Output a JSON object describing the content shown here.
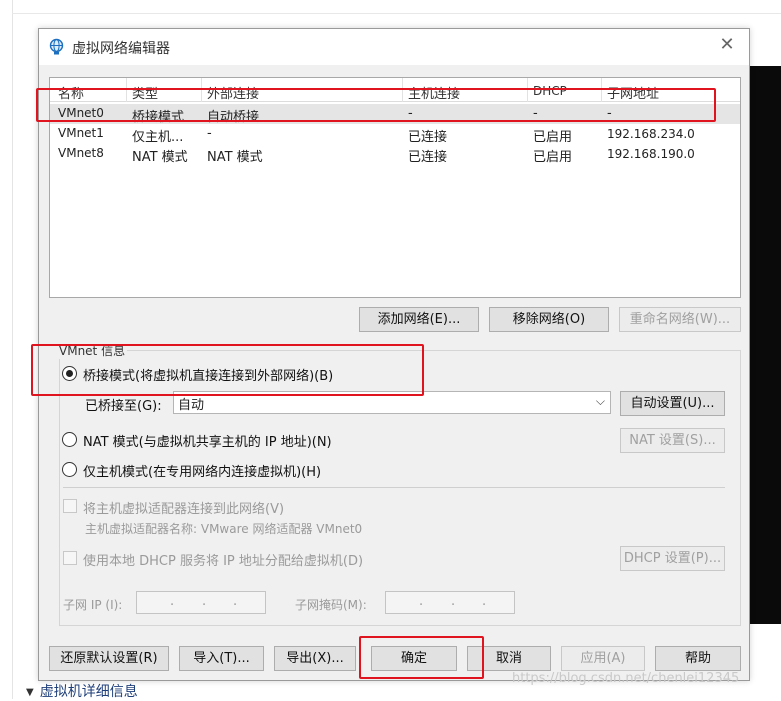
{
  "dialog": {
    "title": "虚拟网络编辑器",
    "close_label": "✕"
  },
  "network_table": {
    "columns": [
      "名称",
      "类型",
      "外部连接",
      "主机连接",
      "DHCP",
      "子网地址"
    ],
    "rows": [
      [
        "VMnet0",
        "桥接模式",
        "自动桥接",
        "-",
        "-",
        "-"
      ],
      [
        "VMnet1",
        "仅主机...",
        "-",
        "已连接",
        "已启用",
        "192.168.234.0"
      ],
      [
        "VMnet8",
        "NAT 模式",
        "NAT 模式",
        "已连接",
        "已启用",
        "192.168.190.0"
      ]
    ],
    "selected_row": 0
  },
  "table_buttons": {
    "add": "添加网络(E)...",
    "remove": "移除网络(O)",
    "rename": "重命名网络(W)..."
  },
  "vmnet_info": {
    "group_label": "VMnet 信息",
    "bridged_label": "桥接模式(将虚拟机直接连接到外部网络)(B)",
    "bridged_to_label": "已桥接至(G):",
    "bridged_to_value": "自动",
    "auto_settings": "自动设置(U)...",
    "nat_label": "NAT 模式(与虚拟机共享主机的 IP 地址)(N)",
    "nat_settings": "NAT 设置(S)...",
    "hostonly_label": "仅主机模式(在专用网络内连接虚拟机)(H)",
    "selected_mode": "bridged",
    "connect_adapter_label": "将主机虚拟适配器连接到此网络(V)",
    "adapter_name_label": "主机虚拟适配器名称: VMware 网络适配器 VMnet0",
    "dhcp_label": "使用本地 DHCP 服务将 IP 地址分配给虚拟机(D)",
    "dhcp_settings": "DHCP 设置(P)...",
    "subnet_ip_label": "子网 IP (I):",
    "subnet_mask_label": "子网掩码(M):"
  },
  "bottom_buttons": {
    "restore": "还原默认设置(R)",
    "import": "导入(T)...",
    "export": "导出(X)...",
    "ok": "确定",
    "cancel": "取消",
    "apply": "应用(A)",
    "help": "帮助"
  },
  "background": {
    "footer_text": "虚拟机详细信息",
    "watermark": "https://blog.csdn.net/chenlei12345"
  },
  "colors": {
    "highlight_box": "#e0141e",
    "dialog_bg": "#f0f0f0",
    "selected_row": "#e5e5e5"
  }
}
